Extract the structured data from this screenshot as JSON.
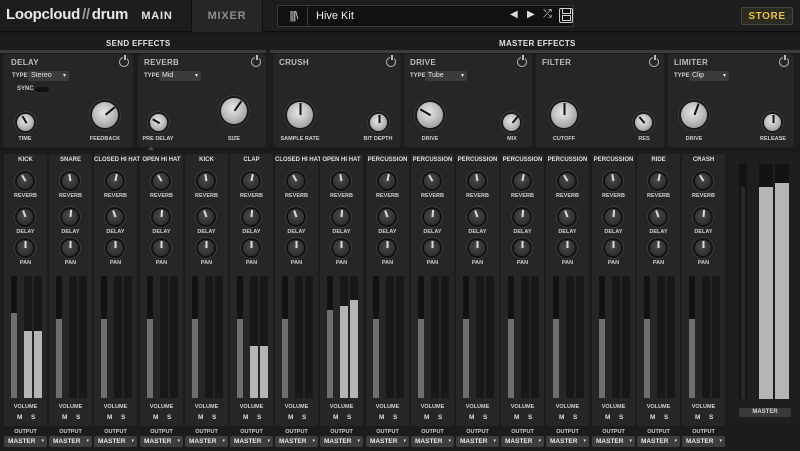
{
  "brand": {
    "logo_a": "Loopcloud",
    "logo_sep": "//",
    "logo_b": "drum"
  },
  "nav": {
    "tabs": [
      {
        "label": "MAIN"
      },
      {
        "label": "MIXER"
      }
    ]
  },
  "preset": {
    "library_icon": "|||\\",
    "name": "Hive Kit",
    "prev_glyph": "◀",
    "next_glyph": "▶",
    "shuffle_glyph": "⤮"
  },
  "actions": {
    "store_label": "STORE"
  },
  "sections": {
    "send": "SEND EFFECTS",
    "master": "MASTER EFFECTS"
  },
  "effects": [
    {
      "name": "DELAY",
      "type_label": "TYPE",
      "type": "Stereo",
      "sync_label": "SYNC",
      "knobs": [
        {
          "label": "TIME"
        },
        {
          "label": "FEEDBACK"
        }
      ]
    },
    {
      "name": "REVERB",
      "type_label": "TYPE",
      "type": "Mid",
      "knobs": [
        {
          "label": "PRE DELAY"
        },
        {
          "label": "SIZE"
        }
      ]
    },
    {
      "name": "CRUSH",
      "knobs": [
        {
          "label": "SAMPLE RATE"
        },
        {
          "label": "BIT DEPTH"
        }
      ]
    },
    {
      "name": "DRIVE",
      "type_label": "TYPE",
      "type": "Tube",
      "knobs": [
        {
          "label": "DRIVE"
        },
        {
          "label": "MIX"
        }
      ]
    },
    {
      "name": "FILTER",
      "knobs": [
        {
          "label": "CUTOFF"
        },
        {
          "label": "RES"
        }
      ]
    },
    {
      "name": "LIMITER",
      "type_label": "TYPE",
      "type": "Clip",
      "knobs": [
        {
          "label": "DRIVE"
        },
        {
          "label": "RELEASE"
        }
      ]
    }
  ],
  "mixer": {
    "knob_labels": {
      "reverb": "REVERB",
      "delay": "DELAY",
      "pan": "PAN"
    },
    "volume_label": "VOLUME",
    "mute_label": "M",
    "solo_label": "S",
    "output_label": "OUTPUT",
    "output_value": "MASTER",
    "master_label": "MASTER",
    "channels": [
      {
        "name": "KICK",
        "fader": 0.7,
        "meter": 0.55
      },
      {
        "name": "SNARE",
        "fader": 0.65,
        "meter": 0
      },
      {
        "name": "CLOSED HI HAT",
        "fader": 0.65,
        "meter": 0
      },
      {
        "name": "OPEN HI HAT",
        "fader": 0.65,
        "meter": 0
      },
      {
        "name": "KICK",
        "fader": 0.65,
        "meter": 0
      },
      {
        "name": "CLAP",
        "fader": 0.65,
        "meter": 0.43
      },
      {
        "name": "CLOSED HI HAT",
        "fader": 0.65,
        "meter": 0
      },
      {
        "name": "OPEN HI HAT",
        "fader": 0.72,
        "meter": 0.75
      },
      {
        "name": "PERCUSSION",
        "fader": 0.65,
        "meter": 0
      },
      {
        "name": "PERCUSSION",
        "fader": 0.65,
        "meter": 0
      },
      {
        "name": "PERCUSSION",
        "fader": 0.65,
        "meter": 0
      },
      {
        "name": "PERCUSSION",
        "fader": 0.65,
        "meter": 0
      },
      {
        "name": "PERCUSSION",
        "fader": 0.65,
        "meter": 0
      },
      {
        "name": "PERCUSSION",
        "fader": 0.65,
        "meter": 0
      },
      {
        "name": "RIDE",
        "fader": 0.65,
        "meter": 0
      },
      {
        "name": "CRASH",
        "fader": 0.65,
        "meter": 0
      }
    ],
    "master": {
      "fader": 0.9,
      "meter_l": 0.9,
      "meter_r": 0.92
    }
  }
}
